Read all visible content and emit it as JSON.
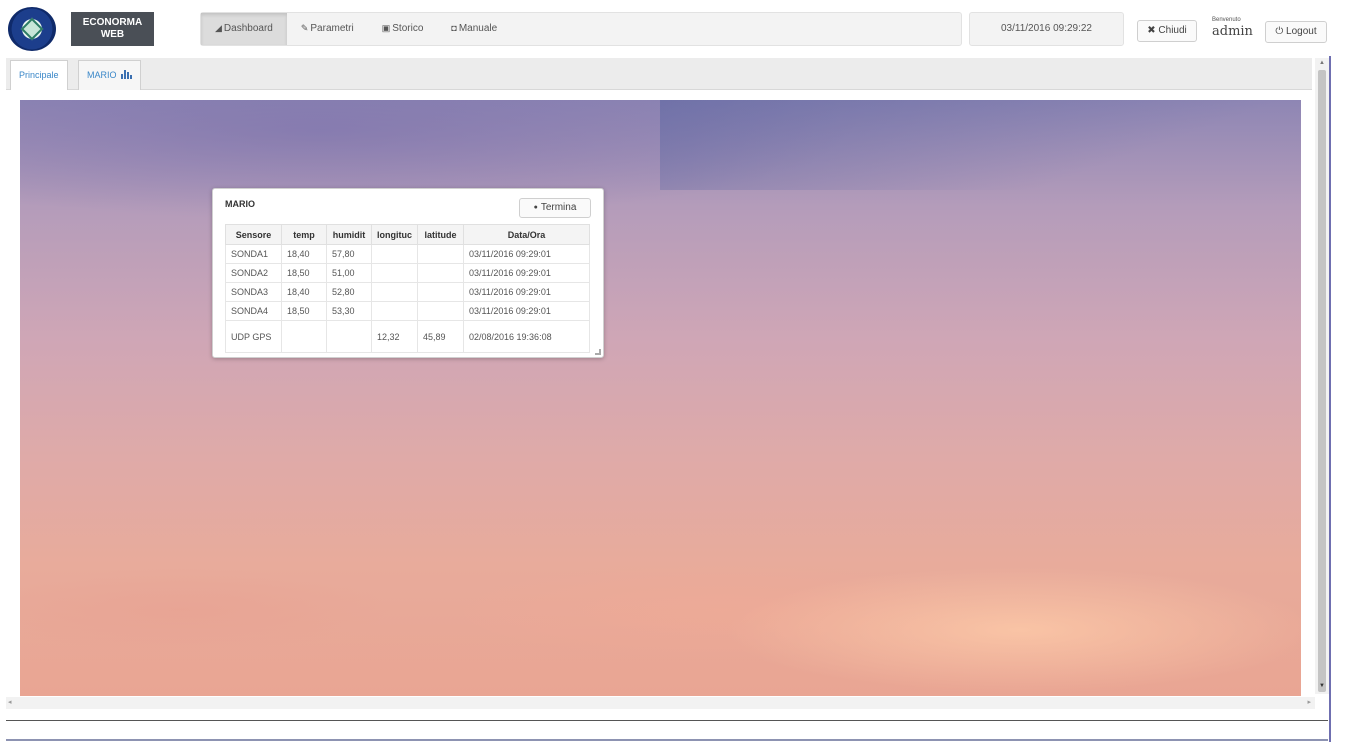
{
  "header": {
    "brand_line1": "ECONORMA",
    "brand_line2": "WEB",
    "nav": [
      {
        "label": "Dashboard",
        "icon": "chart-icon",
        "glyph": "◢",
        "active": true
      },
      {
        "label": "Parametri",
        "icon": "wrench-icon",
        "glyph": "✎",
        "active": false
      },
      {
        "label": "Storico",
        "icon": "database-icon",
        "glyph": "▣",
        "active": false
      },
      {
        "label": "Manuale",
        "icon": "document-icon",
        "glyph": "◘",
        "active": false
      }
    ],
    "datetime": "03/11/2016 09:29:22",
    "close_label": "Chiudi",
    "welcome_label": "Benvenuto",
    "username": "admin",
    "logout_label": "Logout"
  },
  "tabs": [
    {
      "label": "Principale",
      "active": true
    },
    {
      "label": "MARIO",
      "active": false
    }
  ],
  "widget": {
    "title": "MARIO",
    "end_label": "Termina",
    "columns": [
      "Sensore",
      "temp",
      "humidit",
      "longituc",
      "latitude",
      "Data/Ora"
    ],
    "rows": [
      [
        "SONDA1",
        "18,40",
        "57,80",
        "",
        "",
        "03/11/2016 09:29:01"
      ],
      [
        "SONDA2",
        "18,50",
        "51,00",
        "",
        "",
        "03/11/2016 09:29:01"
      ],
      [
        "SONDA3",
        "18,40",
        "52,80",
        "",
        "",
        "03/11/2016 09:29:01"
      ],
      [
        "SONDA4",
        "18,50",
        "53,30",
        "",
        "",
        "03/11/2016 09:29:01"
      ],
      [
        "UDP GPS",
        "",
        "",
        "12,32",
        "45,89",
        "02/08/2016 19:36:08"
      ]
    ]
  },
  "colors": {
    "accent": "#3a87c8",
    "brand_bg": "#4a4f56"
  }
}
